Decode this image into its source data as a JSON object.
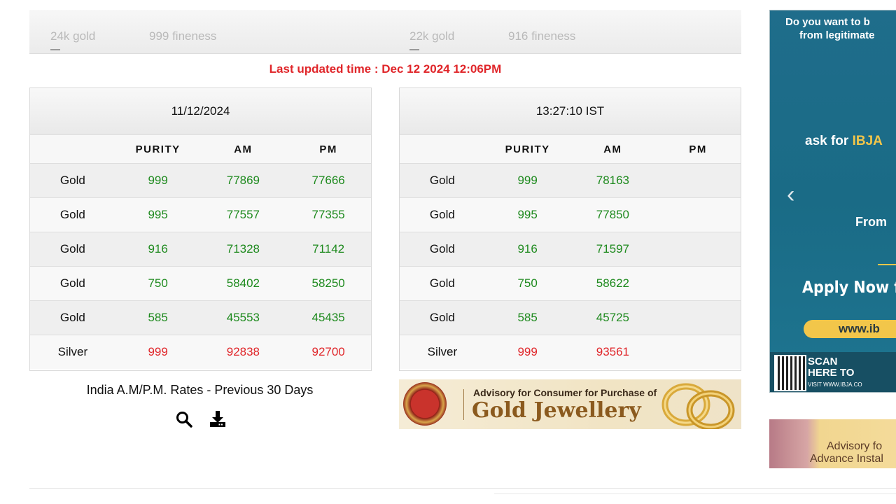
{
  "top_strip": {
    "left_karat": "24k gold",
    "left_fineness": "999 fineness",
    "right_karat": "22k gold",
    "right_fineness": "916 fineness"
  },
  "last_updated": "Last updated time : Dec 12 2024 12:06PM",
  "tables": {
    "headers": [
      "",
      "PURITY",
      "AM",
      "PM"
    ],
    "previous": {
      "title": "11/12/2024",
      "rows": [
        {
          "metal": "Gold",
          "purity": "999",
          "am": "77869",
          "pm": "77666"
        },
        {
          "metal": "Gold",
          "purity": "995",
          "am": "77557",
          "pm": "77355"
        },
        {
          "metal": "Gold",
          "purity": "916",
          "am": "71328",
          "pm": "71142"
        },
        {
          "metal": "Gold",
          "purity": "750",
          "am": "58402",
          "pm": "58250"
        },
        {
          "metal": "Gold",
          "purity": "585",
          "am": "45553",
          "pm": "45435"
        },
        {
          "metal": "Silver",
          "purity": "999",
          "am": "92838",
          "pm": "92700"
        }
      ]
    },
    "current": {
      "title": "13:27:10 IST",
      "rows": [
        {
          "metal": "Gold",
          "purity": "999",
          "am": "78163",
          "pm": ""
        },
        {
          "metal": "Gold",
          "purity": "995",
          "am": "77850",
          "pm": ""
        },
        {
          "metal": "Gold",
          "purity": "916",
          "am": "71597",
          "pm": ""
        },
        {
          "metal": "Gold",
          "purity": "750",
          "am": "58622",
          "pm": ""
        },
        {
          "metal": "Gold",
          "purity": "585",
          "am": "45725",
          "pm": ""
        },
        {
          "metal": "Silver",
          "purity": "999",
          "am": "93561",
          "pm": ""
        }
      ]
    }
  },
  "previous_30_days_label": "India A.M/P.M. Rates - Previous 30 Days",
  "icons": {
    "search": "search-icon",
    "download": "download-icon"
  },
  "advisory_banner": {
    "line1": "Advisory for Consumer for Purchase of",
    "line2": "Gold Jewellery"
  },
  "right_ad": {
    "headline1": "Do you want to b",
    "headline2": "from legitimate",
    "ask_prefix": "ask for ",
    "ask_brand": "IBJA",
    "from": "From",
    "apply": "Apply Now f",
    "url": "www.ib",
    "scan1": "SCAN",
    "scan2": "HERE TO",
    "visit": "VISIT WWW.IBJA.CO"
  },
  "right_ad2": {
    "line1": "Advisory fo",
    "line2": "Advance Instal"
  },
  "colors": {
    "accent_red": "#e0262a",
    "value_green": "#1e8a1e",
    "ad_blue": "#1f6d8b",
    "ad_gold": "#f2c64a"
  }
}
